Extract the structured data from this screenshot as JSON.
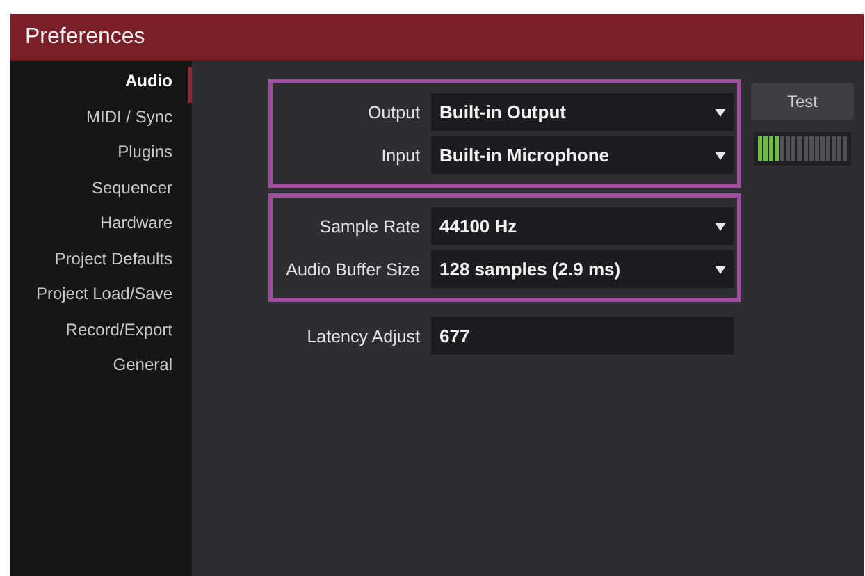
{
  "window": {
    "title": "Preferences"
  },
  "sidebar": {
    "items": [
      {
        "label": "Audio",
        "selected": true
      },
      {
        "label": "MIDI / Sync",
        "selected": false
      },
      {
        "label": "Plugins",
        "selected": false
      },
      {
        "label": "Sequencer",
        "selected": false
      },
      {
        "label": "Hardware",
        "selected": false
      },
      {
        "label": "Project Defaults",
        "selected": false
      },
      {
        "label": "Project Load/Save",
        "selected": false
      },
      {
        "label": "Record/Export",
        "selected": false
      },
      {
        "label": "General",
        "selected": false
      }
    ]
  },
  "settings": {
    "groups": [
      {
        "highlighted": true,
        "fields": [
          {
            "label": "Output",
            "kind": "dropdown",
            "value": "Built-in Output"
          },
          {
            "label": "Input",
            "kind": "dropdown",
            "value": "Built-in Microphone"
          }
        ]
      },
      {
        "highlighted": true,
        "fields": [
          {
            "label": "Sample Rate",
            "kind": "dropdown",
            "value": "44100 Hz"
          },
          {
            "label": "Audio Buffer Size",
            "kind": "dropdown",
            "value": "128 samples (2.9 ms)"
          }
        ]
      },
      {
        "highlighted": false,
        "fields": [
          {
            "label": "Latency Adjust",
            "kind": "text",
            "value": "677"
          }
        ]
      }
    ]
  },
  "test_button": {
    "label": "Test"
  },
  "input_meter": {
    "level": 0.25
  }
}
